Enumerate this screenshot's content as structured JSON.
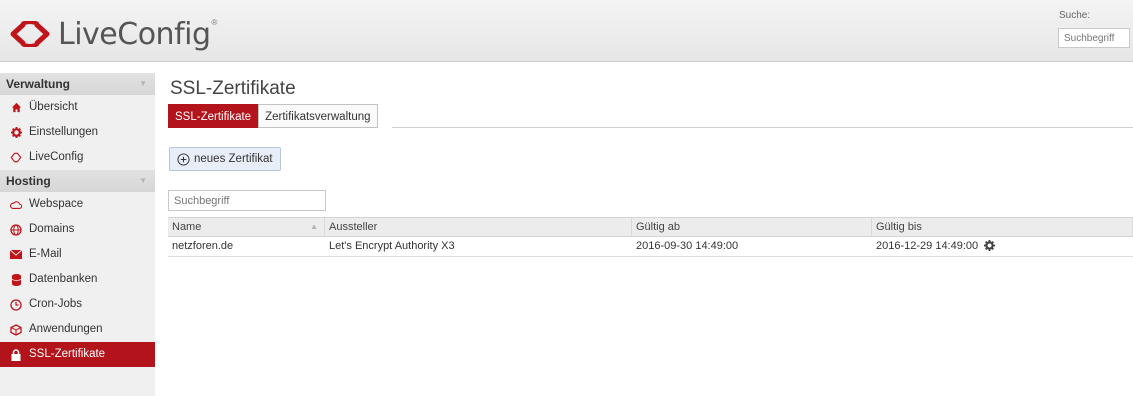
{
  "header": {
    "logo_text": "LiveConfig",
    "logo_reg": "®",
    "search_label": "Suche:",
    "search_placeholder": "Suchbegriff"
  },
  "sidebar": {
    "sections": [
      {
        "label": "Verwaltung",
        "items": [
          {
            "label": "Übersicht",
            "icon": "home-icon"
          },
          {
            "label": "Einstellungen",
            "icon": "gear-icon"
          },
          {
            "label": "LiveConfig",
            "icon": "liveconfig-logo-icon"
          }
        ]
      },
      {
        "label": "Hosting",
        "items": [
          {
            "label": "Webspace",
            "icon": "cloud-icon"
          },
          {
            "label": "Domains",
            "icon": "globe-icon"
          },
          {
            "label": "E-Mail",
            "icon": "mail-icon"
          },
          {
            "label": "Datenbanken",
            "icon": "database-icon"
          },
          {
            "label": "Cron-Jobs",
            "icon": "clock-icon"
          },
          {
            "label": "Anwendungen",
            "icon": "package-icon"
          },
          {
            "label": "SSL-Zertifikate",
            "icon": "lock-icon",
            "active": true
          }
        ]
      }
    ]
  },
  "main": {
    "title": "SSL-Zertifikate",
    "tabs": [
      {
        "label": "SSL-Zertifikate",
        "active": true
      },
      {
        "label": "Zertifikatsverwaltung",
        "active": false
      }
    ],
    "new_button": "neues Zertifikat",
    "filter_placeholder": "Suchbegriff",
    "table": {
      "columns": [
        "Name",
        "Aussteller",
        "Gültig ab",
        "Gültig bis"
      ],
      "rows": [
        [
          "netzforen.de",
          "Let's Encrypt Authority X3",
          "2016-09-30 14:49:00",
          "2016-12-29 14:49:00"
        ]
      ]
    }
  },
  "colors": {
    "accent": "#b3141b",
    "sidebar_bg": "#f0f0f0",
    "button_bg": "#e7eef7"
  }
}
